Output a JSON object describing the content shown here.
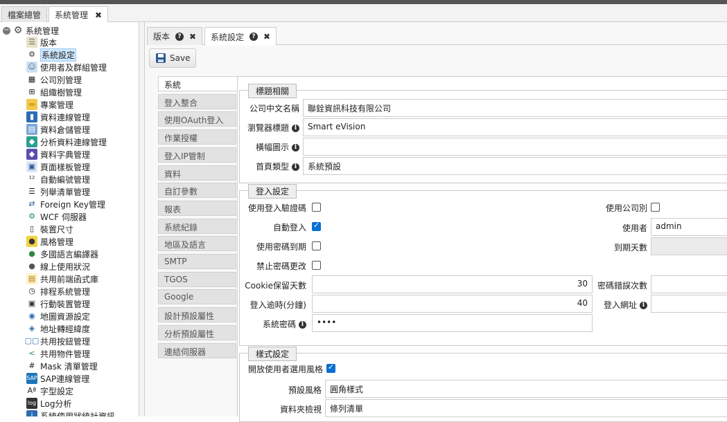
{
  "outer_tabs": [
    {
      "label": "檔案總管"
    },
    {
      "label": "系統管理",
      "close": "✖"
    }
  ],
  "tree": {
    "root": "系統管理",
    "items": [
      {
        "label": "版本",
        "icon": "document-icon"
      },
      {
        "label": "系統設定",
        "icon": "gear-icon",
        "selected": true
      },
      {
        "label": "使用者及群組管理",
        "icon": "users-icon"
      },
      {
        "label": "公司別管理",
        "icon": "building-icon"
      },
      {
        "label": "組織樹管理",
        "icon": "org-tree-icon"
      },
      {
        "label": "專案管理",
        "icon": "folder-icon"
      },
      {
        "label": "資料連線管理",
        "icon": "database-icon"
      },
      {
        "label": "資料倉儲管理",
        "icon": "warehouse-icon"
      },
      {
        "label": "分析資料連線管理",
        "icon": "cube-icon"
      },
      {
        "label": "資料字典管理",
        "icon": "book-icon"
      },
      {
        "label": "頁面樣板管理",
        "icon": "template-icon"
      },
      {
        "label": "自動編號管理",
        "icon": "numbering-icon"
      },
      {
        "label": "列舉清單管理",
        "icon": "list-icon"
      },
      {
        "label": "Foreign Key管理",
        "icon": "key-icon"
      },
      {
        "label": "WCF 伺服器",
        "icon": "server-icon"
      },
      {
        "label": "裝置尺寸",
        "icon": "device-icon"
      },
      {
        "label": "風格管理",
        "icon": "palette-icon"
      },
      {
        "label": "多國語言編譯器",
        "icon": "globe-icon"
      },
      {
        "label": "線上使用狀況",
        "icon": "user-online-icon"
      },
      {
        "label": "共用前端函式庫",
        "icon": "library-icon"
      },
      {
        "label": "排程系統管理",
        "icon": "clock-icon"
      },
      {
        "label": "行動裝置管理",
        "icon": "mobile-icon"
      },
      {
        "label": "地圖資源設定",
        "icon": "map-icon"
      },
      {
        "label": "地址轉經緯度",
        "icon": "geocode-icon"
      },
      {
        "label": "共用按鈕管理",
        "icon": "buttons-icon"
      },
      {
        "label": "共用物件管理",
        "icon": "share-icon"
      },
      {
        "label": "Mask 清單管理",
        "icon": "hash-icon"
      },
      {
        "label": "SAP連線管理",
        "icon": "sap-icon"
      },
      {
        "label": "字型設定",
        "icon": "font-icon"
      },
      {
        "label": "Log分析",
        "icon": "log-icon"
      },
      {
        "label": "系統使用狀統計資訊",
        "icon": "info-icon"
      }
    ]
  },
  "inner_tabs": [
    {
      "label": "版本"
    },
    {
      "label": "系統設定"
    }
  ],
  "toolbar": {
    "save_label": "Save"
  },
  "vtabs": [
    "系統",
    "登入整合",
    "使用OAuth登入",
    "作業授權",
    "登入IP管制",
    "資料",
    "自訂參數",
    "報表",
    "系統紀錄",
    "地區及語言",
    "SMTP",
    "TGOS",
    "Google",
    "設計預設屬性",
    "分析預設屬性",
    "連結伺服器"
  ],
  "title_section": {
    "legend": "標題相關",
    "company_label": "公司中文名稱",
    "company_value": "聯銓資訊科技有限公司",
    "browser_title_label": "瀏覽器標題",
    "browser_title_value": "Smart eVision",
    "banner_label": "橫幅圖示",
    "banner_value": "",
    "homepage_label": "首頁類型",
    "homepage_value": "系統預設"
  },
  "login_section": {
    "legend": "登入設定",
    "captcha_label": "使用登入驗證碼",
    "captcha_checked": false,
    "company_use_label": "使用公司別",
    "company_use_checked": false,
    "auto_login_label": "自動登入",
    "auto_login_checked": true,
    "user_label": "使用者",
    "user_value": "admin",
    "pwd_expire_label": "使用密碼到期",
    "pwd_expire_checked": false,
    "expire_days_label": "到期天數",
    "expire_days_value": "",
    "no_pwd_change_label": "禁止密碼更改",
    "no_pwd_change_checked": false,
    "cookie_days_label": "Cookie保留天數",
    "cookie_days_value": "30",
    "pwd_error_label": "密碼錯誤次數",
    "pwd_error_value": "",
    "timeout_label": "登入逾時(分鐘)",
    "timeout_value": "40",
    "login_url_label": "登入網址",
    "login_url_value": "",
    "sys_pwd_label": "系統密碼",
    "sys_pwd_value": "••••"
  },
  "style_section": {
    "legend": "樣式設定",
    "open_user_style_label": "開放使用者選用風格",
    "open_user_style_checked": true,
    "default_style_label": "預設風格",
    "default_style_value": "圓角樣式",
    "folder_view_label": "資料夾檢視",
    "folder_view_value": "條列清單"
  }
}
